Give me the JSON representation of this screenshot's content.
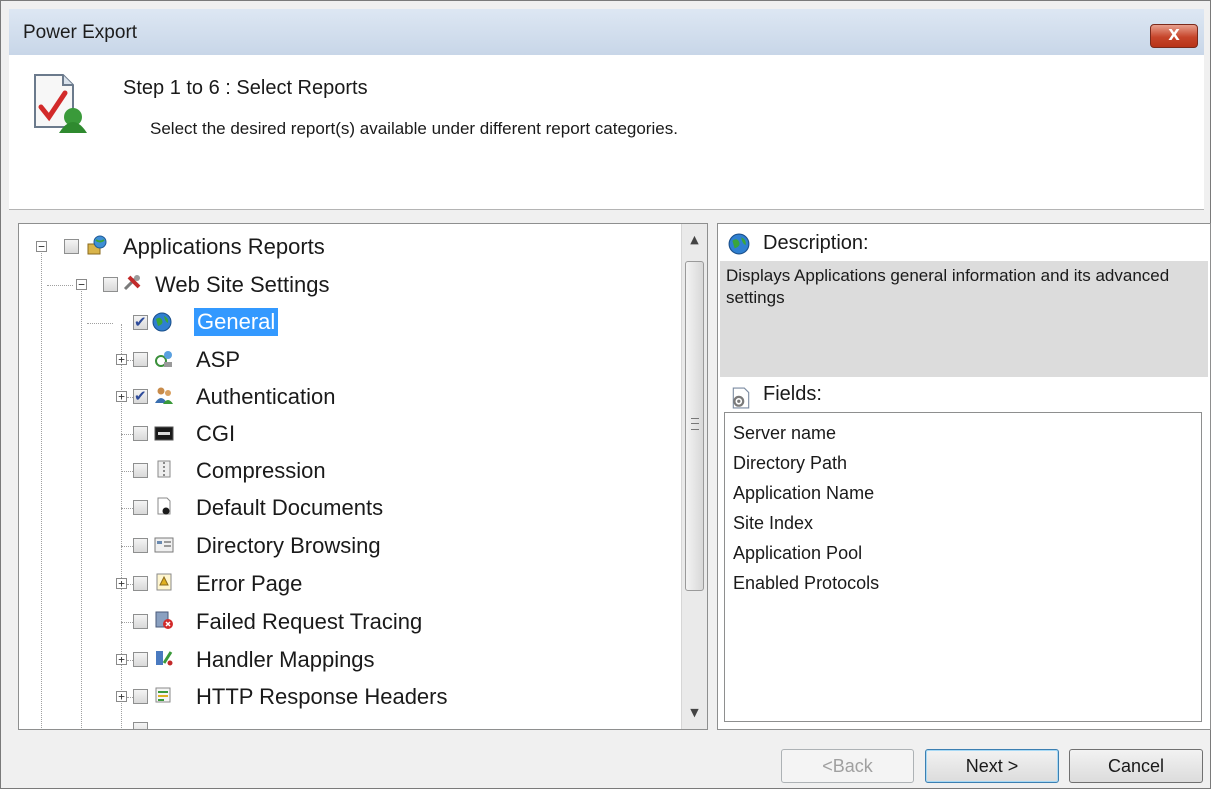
{
  "window": {
    "title": "Power Export",
    "close_label": "X"
  },
  "header": {
    "step_title": "Step 1 to 6 : Select Reports",
    "step_description": "Select the desired report(s) available under different report categories."
  },
  "tree": {
    "items": [
      {
        "label": "Applications Reports",
        "checked": false,
        "expander": "minus",
        "icon": "globe-folder-icon"
      },
      {
        "label": "Web Site Settings",
        "checked": false,
        "expander": "minus",
        "icon": "settings-tools-icon"
      },
      {
        "label": "General",
        "checked": true,
        "expander": "none",
        "icon": "globe-icon",
        "selected": true
      },
      {
        "label": "ASP",
        "checked": false,
        "expander": "plus",
        "icon": "asp-icon"
      },
      {
        "label": "Authentication",
        "checked": true,
        "expander": "plus",
        "icon": "users-icon"
      },
      {
        "label": "CGI",
        "checked": false,
        "expander": "none",
        "icon": "cgi-icon"
      },
      {
        "label": "Compression",
        "checked": false,
        "expander": "none",
        "icon": "compression-icon"
      },
      {
        "label": "Default Documents",
        "checked": false,
        "expander": "none",
        "icon": "document-icon"
      },
      {
        "label": "Directory Browsing",
        "checked": false,
        "expander": "none",
        "icon": "directory-browsing-icon"
      },
      {
        "label": "Error Page",
        "checked": false,
        "expander": "plus",
        "icon": "error-page-icon"
      },
      {
        "label": "Failed Request Tracing",
        "checked": false,
        "expander": "none",
        "icon": "failed-request-icon"
      },
      {
        "label": "Handler Mappings",
        "checked": false,
        "expander": "plus",
        "icon": "handler-mappings-icon"
      },
      {
        "label": "HTTP Response Headers",
        "checked": false,
        "expander": "plus",
        "icon": "http-headers-icon"
      }
    ]
  },
  "description": {
    "heading": "Description:",
    "text": "Displays Applications general information and its advanced settings"
  },
  "fields": {
    "heading": "Fields:",
    "items": [
      "Server name",
      "Directory Path",
      "Application Name",
      "Site Index",
      "Application Pool",
      "Enabled Protocols"
    ]
  },
  "buttons": {
    "back": "<Back",
    "next": "Next >",
    "cancel": "Cancel"
  }
}
